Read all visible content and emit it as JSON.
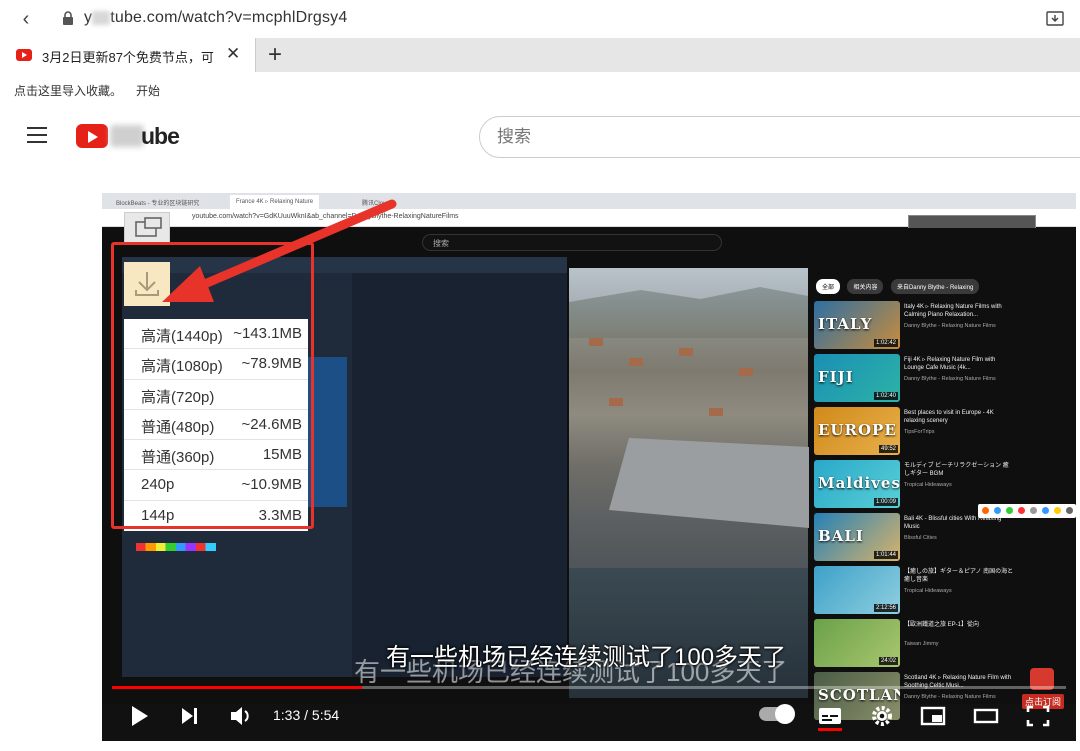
{
  "browser": {
    "url_prefix": "y",
    "url_suffix": "tube.com/watch?v=mcphlDrgsy4",
    "tab_title": "3月2日更新87个免费节点，可",
    "tab_close": "✕",
    "new_tab": "+",
    "bookmark_hint": "点击这里导入收藏。",
    "bookmark_start": "开始"
  },
  "youtube": {
    "logo_text": "ube",
    "search_placeholder": "搜索"
  },
  "download_menu": {
    "options": [
      {
        "quality": "高清(1440p)",
        "size": "~143.1MB"
      },
      {
        "quality": "高清(1080p)",
        "size": "~78.9MB"
      },
      {
        "quality": "高清(720p)",
        "size": ""
      },
      {
        "quality": "普通(480p)",
        "size": "~24.6MB"
      },
      {
        "quality": "普通(360p)",
        "size": "15MB"
      },
      {
        "quality": "240p",
        "size": "~10.9MB"
      },
      {
        "quality": "144p",
        "size": "3.3MB"
      }
    ]
  },
  "inner_recording": {
    "tabs": [
      "BlockBeats - 专业的区块链研究",
      "France 4K ▹ Relaxing Nature",
      "腾讯Cloud"
    ],
    "url": "youtube.com/watch?v=GdKUuuWknI&ab_channel=DannyBlythe-RelaxingNatureFilms",
    "search": "搜索",
    "chips": [
      "全部",
      "相关内容",
      "来自Danny Blythe - Relaxing"
    ],
    "recommendations": [
      {
        "thumb_label": "ITALY",
        "duration": "1:02:42",
        "title": "Italy 4K ▹ Relaxing Nature Films with Calming Piano Relaxation...",
        "channel": "Danny Blythe - Relaxing Nature Films",
        "colors": [
          "#2d6fa3",
          "#c98c3b"
        ]
      },
      {
        "thumb_label": "FIJI",
        "duration": "1:02:40",
        "title": "Fiji 4K ▹ Relaxing Nature Film with Lounge Cafe Music (4k...",
        "channel": "Danny Blythe - Relaxing Nature Films",
        "colors": [
          "#1b8fb5",
          "#2cb3a7"
        ]
      },
      {
        "thumb_label": "EUROPE",
        "duration": "49:52",
        "title": "Best places to visit in Europe - 4K relaxing scenery",
        "channel": "TipsForTrips",
        "colors": [
          "#d18a1a",
          "#e7b04b"
        ]
      },
      {
        "thumb_label": "Maldives",
        "duration": "1:00:09",
        "title": "モルディブ ビーチリラクゼーション 癒しギター BGM",
        "channel": "Tropical Hideaways",
        "colors": [
          "#2aa8c9",
          "#58d0d6"
        ]
      },
      {
        "thumb_label": "BALI",
        "duration": "1:01:44",
        "title": "Bali 4K - Blissful cities With Relaxing Music",
        "channel": "Blissful Cities",
        "colors": [
          "#2481b8",
          "#d8b36a"
        ]
      },
      {
        "thumb_label": "",
        "duration": "2:12:56",
        "title": "【癒しの旅】ギター＆ピアノ 南国の海と癒し音楽",
        "channel": "Tropical Hideaways",
        "colors": [
          "#3ea1c8",
          "#8fcfe0"
        ]
      },
      {
        "thumb_label": "",
        "duration": "24:02",
        "title": "【歐洲鐵道之旅 EP-1】從向",
        "channel": "Taiwan Jimmy",
        "colors": [
          "#6aa14a",
          "#a9c76e"
        ]
      },
      {
        "thumb_label": "SCOTLAND",
        "duration": "",
        "title": "Scotland 4K ▹ Relaxing Nature Film with Soothing Celtic Musi...",
        "channel": "Danny Blythe - Relaxing Nature Films",
        "colors": [
          "#4b5d46",
          "#8a8f6a"
        ]
      }
    ],
    "subscribe_label": "点击订阅"
  },
  "captions": {
    "main": "有一些机场已经连续测试了100多天了",
    "ghost": "有一些机场已经连续测试了100多天了"
  },
  "player": {
    "current_time": "1:33",
    "duration": "5:54",
    "time_separator": " / ",
    "progress_fraction": 0.262
  },
  "colors": {
    "accent_red": "#ff0000",
    "frame_red": "#e8332a",
    "youtube_red": "#e62117"
  }
}
